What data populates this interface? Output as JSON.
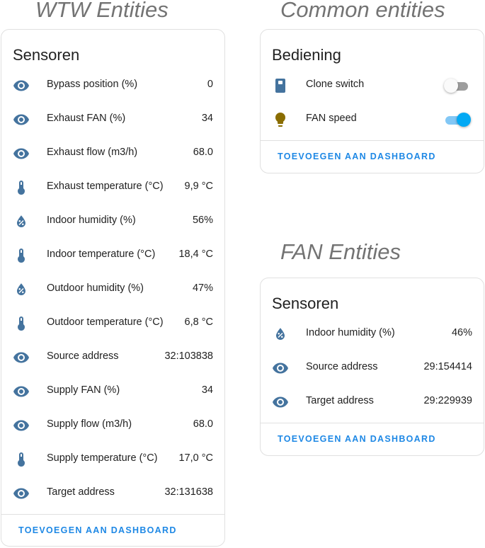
{
  "sections": {
    "wtw_heading": "WTW Entities",
    "common_heading": "Common entities",
    "fan_heading": "FAN Entities"
  },
  "colors": {
    "icon": "#44739e",
    "bulb": "#8a6d00",
    "accent": "#03a9f4",
    "action_text": "#1e88e5"
  },
  "wtw_card": {
    "title": "Sensoren",
    "rows": [
      {
        "icon": "eye-icon",
        "label": "Bypass position (%)",
        "value": "0"
      },
      {
        "icon": "eye-icon",
        "label": "Exhaust FAN (%)",
        "value": "34"
      },
      {
        "icon": "eye-icon",
        "label": "Exhaust flow (m3/h)",
        "value": "68.0"
      },
      {
        "icon": "thermometer-icon",
        "label": "Exhaust temperature (°C)",
        "value": "9,9 °C"
      },
      {
        "icon": "humidity-icon",
        "label": "Indoor humidity (%)",
        "value": "56%"
      },
      {
        "icon": "thermometer-icon",
        "label": "Indoor temperature (°C)",
        "value": "18,4 °C"
      },
      {
        "icon": "humidity-icon",
        "label": "Outdoor humidity (%)",
        "value": "47%"
      },
      {
        "icon": "thermometer-icon",
        "label": "Outdoor temperature (°C)",
        "value": "6,8 °C"
      },
      {
        "icon": "eye-icon",
        "label": "Source address",
        "value": "32:103838"
      },
      {
        "icon": "eye-icon",
        "label": "Supply FAN (%)",
        "value": "34"
      },
      {
        "icon": "eye-icon",
        "label": "Supply flow (m3/h)",
        "value": "68.0"
      },
      {
        "icon": "thermometer-icon",
        "label": "Supply temperature (°C)",
        "value": "17,0 °C"
      },
      {
        "icon": "eye-icon",
        "label": "Target address",
        "value": "32:131638"
      }
    ],
    "action": "TOEVOEGEN AAN DASHBOARD"
  },
  "common_card": {
    "title": "Bediening",
    "rows": [
      {
        "icon": "remote-switch-icon",
        "label": "Clone switch",
        "state": "off"
      },
      {
        "icon": "lightbulb-icon",
        "label": "FAN speed",
        "state": "on"
      }
    ],
    "action": "TOEVOEGEN AAN DASHBOARD"
  },
  "fan_card": {
    "title": "Sensoren",
    "rows": [
      {
        "icon": "humidity-icon",
        "label": "Indoor humidity (%)",
        "value": "46%"
      },
      {
        "icon": "eye-icon",
        "label": "Source address",
        "value": "29:154414"
      },
      {
        "icon": "eye-icon",
        "label": "Target address",
        "value": "29:229939"
      }
    ],
    "action": "TOEVOEGEN AAN DASHBOARD"
  }
}
